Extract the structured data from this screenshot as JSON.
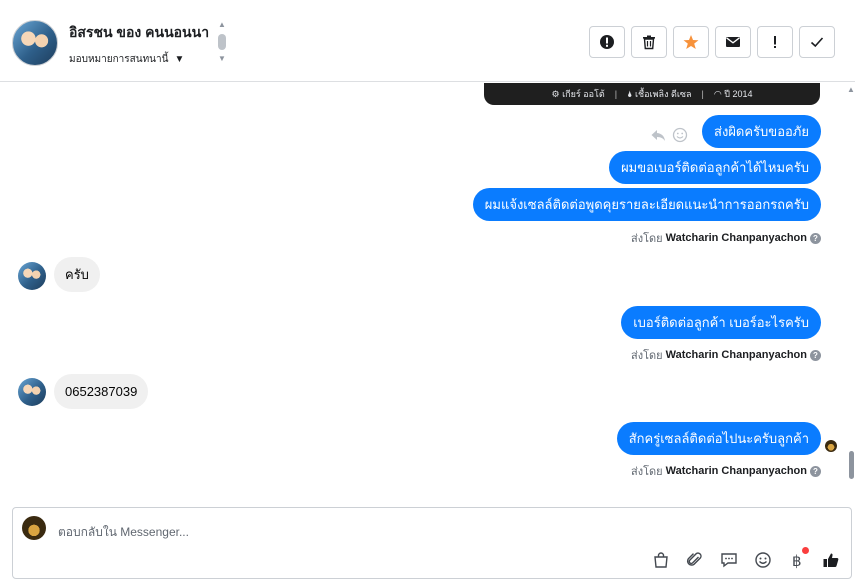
{
  "header": {
    "contact_name": "อิสรชน ของ คนนอนนา",
    "assign_label": "มอบหมายการสนทนานี้",
    "actions": [
      "spam-icon",
      "trash-icon",
      "star-icon",
      "mail-icon",
      "follow-up-icon",
      "done-icon"
    ]
  },
  "card": {
    "gear": "⚙ เกียร์ ออโต้",
    "fuel": "🌢 เชื้อเพลิง ดีเซล",
    "year": "◠ ปี 2014"
  },
  "messages": {
    "out1": "ส่งผิดครับขออภัย",
    "out2": "ผมขอเบอร์ติดต่อลูกค้าได้ไหมครับ",
    "out3": "ผมแจ้งเซลล์ติดต่อพูดคุยรายละเอียดแนะนำการออกรถครับ",
    "in1": "ครับ",
    "out4": "เบอร์ติดต่อลูกค้า เบอร์อะไรครับ",
    "in2": "0652387039",
    "out5": "สักครู่เซลล์ติดต่อไปนะครับลูกค้า"
  },
  "sent_by": {
    "prefix": "ส่งโดย",
    "name": "Watcharin Chanpanyachon"
  },
  "composer": {
    "placeholder": "ตอบกลับใน Messenger..."
  },
  "colors": {
    "accent_blue": "#0a7cff",
    "incoming_bg": "#f0f0f0",
    "star_orange": "#f7923b",
    "badge_red": "#fa3e3e"
  }
}
